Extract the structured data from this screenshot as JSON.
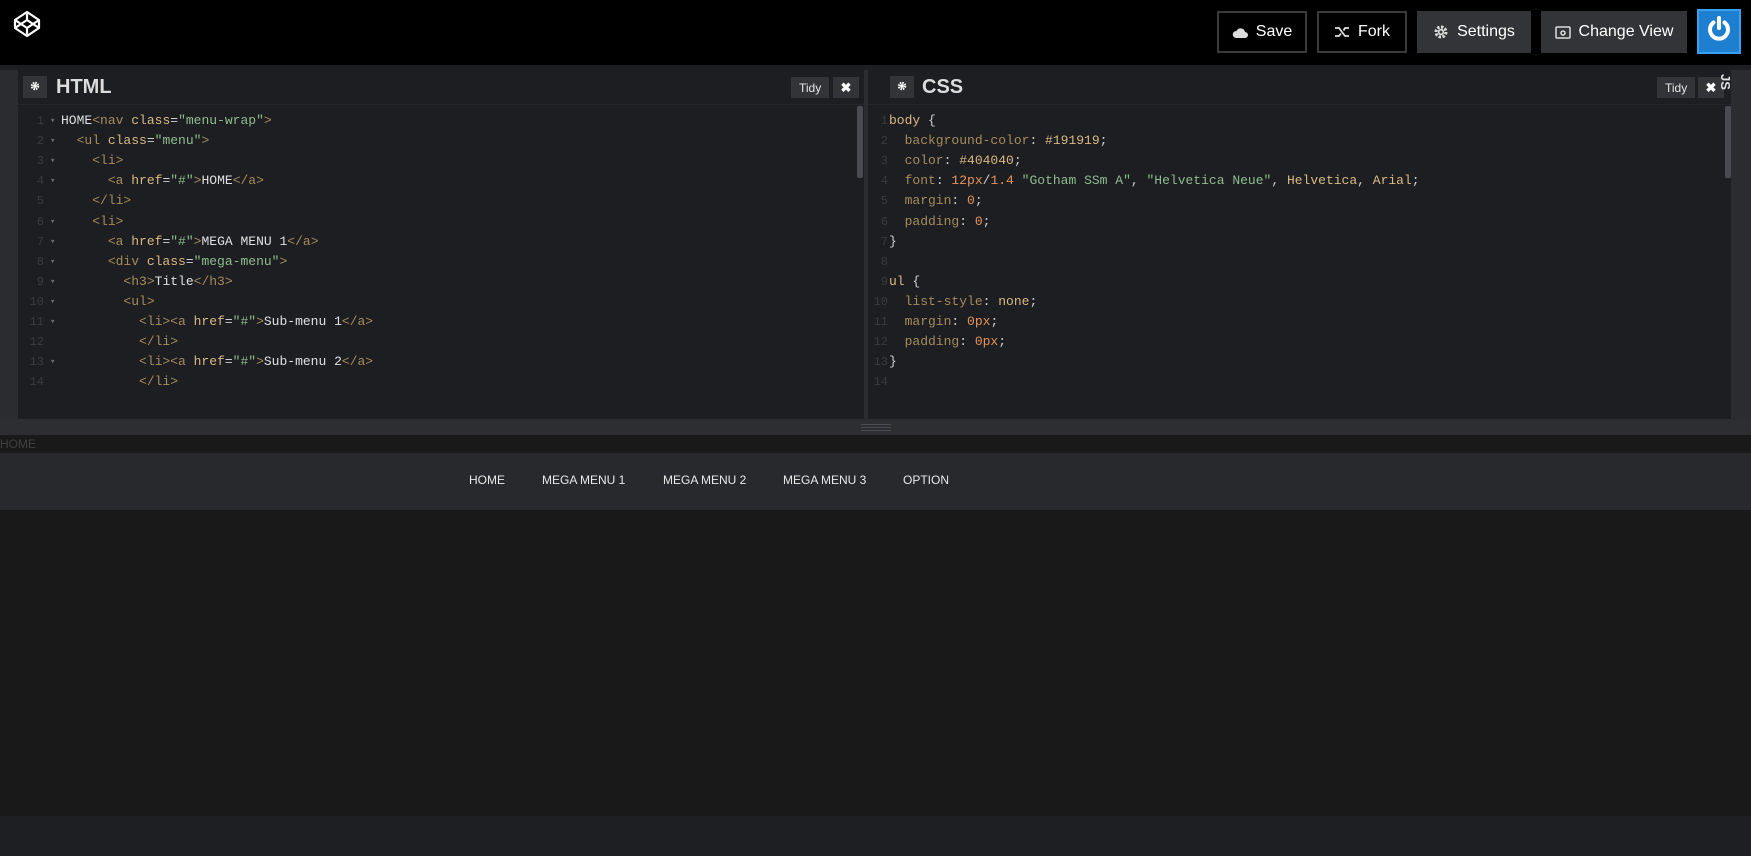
{
  "header": {
    "logo_icon": "codepen-cube-icon",
    "save_label": "Save",
    "fork_label": "Fork",
    "settings_label": "Settings",
    "change_view_label": "Change View",
    "account_icon": "power-icon",
    "accent_color": "#1e7fd0"
  },
  "html_pane": {
    "title": "HTML",
    "tidy_label": "Tidy",
    "close_label": "✖",
    "lines": [
      {
        "n": "1",
        "fold": "▾",
        "code": [
          [
            "tx",
            "HOME"
          ],
          [
            "tg",
            "<nav "
          ],
          [
            "at",
            "class"
          ],
          [
            "pu",
            "="
          ],
          [
            "st",
            "\"menu-wrap\""
          ],
          [
            "tg",
            ">"
          ]
        ]
      },
      {
        "n": "2",
        "fold": "▾",
        "code": [
          [
            "tx",
            "  "
          ],
          [
            "tg",
            "<ul "
          ],
          [
            "at",
            "class"
          ],
          [
            "pu",
            "="
          ],
          [
            "st",
            "\"menu\""
          ],
          [
            "tg",
            ">"
          ]
        ]
      },
      {
        "n": "3",
        "fold": "▾",
        "code": [
          [
            "tx",
            "    "
          ],
          [
            "tg",
            "<li>"
          ]
        ]
      },
      {
        "n": "4",
        "fold": "▾",
        "code": [
          [
            "tx",
            "      "
          ],
          [
            "tg",
            "<a "
          ],
          [
            "at",
            "href"
          ],
          [
            "pu",
            "="
          ],
          [
            "st",
            "\"#\""
          ],
          [
            "tg",
            ">"
          ],
          [
            "tx",
            "HOME"
          ],
          [
            "tg",
            "</a>"
          ]
        ]
      },
      {
        "n": "5",
        "fold": "",
        "code": [
          [
            "tx",
            "    "
          ],
          [
            "tg",
            "</li>"
          ]
        ]
      },
      {
        "n": "6",
        "fold": "▾",
        "code": [
          [
            "tx",
            "    "
          ],
          [
            "tg",
            "<li>"
          ]
        ]
      },
      {
        "n": "7",
        "fold": "▾",
        "code": [
          [
            "tx",
            "      "
          ],
          [
            "tg",
            "<a "
          ],
          [
            "at",
            "href"
          ],
          [
            "pu",
            "="
          ],
          [
            "st",
            "\"#\""
          ],
          [
            "tg",
            ">"
          ],
          [
            "tx",
            "MEGA MENU 1"
          ],
          [
            "tg",
            "</a>"
          ]
        ]
      },
      {
        "n": "8",
        "fold": "▾",
        "code": [
          [
            "tx",
            "      "
          ],
          [
            "tg",
            "<div "
          ],
          [
            "at",
            "class"
          ],
          [
            "pu",
            "="
          ],
          [
            "st",
            "\"mega-menu\""
          ],
          [
            "tg",
            ">"
          ]
        ]
      },
      {
        "n": "9",
        "fold": "▾",
        "code": [
          [
            "tx",
            "        "
          ],
          [
            "tg",
            "<h3>"
          ],
          [
            "tx",
            "Title"
          ],
          [
            "tg",
            "</h3>"
          ]
        ]
      },
      {
        "n": "10",
        "fold": "▾",
        "code": [
          [
            "tx",
            "        "
          ],
          [
            "tg",
            "<ul>"
          ]
        ]
      },
      {
        "n": "11",
        "fold": "▾",
        "code": [
          [
            "tx",
            "          "
          ],
          [
            "tg",
            "<li><a "
          ],
          [
            "at",
            "href"
          ],
          [
            "pu",
            "="
          ],
          [
            "st",
            "\"#\""
          ],
          [
            "tg",
            ">"
          ],
          [
            "tx",
            "Sub-menu 1"
          ],
          [
            "tg",
            "</a>"
          ]
        ]
      },
      {
        "n": "12",
        "fold": "",
        "code": [
          [
            "tx",
            "          "
          ],
          [
            "tg",
            "</li>"
          ]
        ]
      },
      {
        "n": "13",
        "fold": "▾",
        "code": [
          [
            "tx",
            "          "
          ],
          [
            "tg",
            "<li><a "
          ],
          [
            "at",
            "href"
          ],
          [
            "pu",
            "="
          ],
          [
            "st",
            "\"#\""
          ],
          [
            "tg",
            ">"
          ],
          [
            "tx",
            "Sub-menu 2"
          ],
          [
            "tg",
            "</a>"
          ]
        ]
      },
      {
        "n": "14",
        "fold": "",
        "code": [
          [
            "tx",
            "          "
          ],
          [
            "tg",
            "</li>"
          ]
        ]
      }
    ]
  },
  "css_pane": {
    "title": "CSS",
    "tidy_label": "Tidy",
    "close_label": "✖",
    "lines": [
      {
        "n": "1",
        "code": [
          [
            "sel",
            "body"
          ],
          [
            "pu",
            " {"
          ]
        ]
      },
      {
        "n": "2",
        "code": [
          [
            "pr",
            "  background-color"
          ],
          [
            "pu",
            ": "
          ],
          [
            "hex",
            "#191919"
          ],
          [
            "pu",
            ";"
          ]
        ]
      },
      {
        "n": "3",
        "code": [
          [
            "pr",
            "  color"
          ],
          [
            "pu",
            ": "
          ],
          [
            "hex",
            "#404040"
          ],
          [
            "pu",
            ";"
          ]
        ]
      },
      {
        "n": "4",
        "code": [
          [
            "pr",
            "  font"
          ],
          [
            "pu",
            ": "
          ],
          [
            "num",
            "12px"
          ],
          [
            "pu",
            "/"
          ],
          [
            "num",
            "1.4"
          ],
          [
            "pu",
            " "
          ],
          [
            "st",
            "\"Gotham SSm A\""
          ],
          [
            "pu",
            ", "
          ],
          [
            "st",
            "\"Helvetica Neue\""
          ],
          [
            "pu",
            ", "
          ],
          [
            "hex",
            "Helvetica"
          ],
          [
            "pu",
            ", "
          ],
          [
            "hex",
            "Arial"
          ],
          [
            "pu",
            ";"
          ]
        ]
      },
      {
        "n": "5",
        "code": [
          [
            "pr",
            "  margin"
          ],
          [
            "pu",
            ": "
          ],
          [
            "num",
            "0"
          ],
          [
            "pu",
            ";"
          ]
        ]
      },
      {
        "n": "6",
        "code": [
          [
            "pr",
            "  padding"
          ],
          [
            "pu",
            ": "
          ],
          [
            "num",
            "0"
          ],
          [
            "pu",
            ";"
          ]
        ]
      },
      {
        "n": "7",
        "code": [
          [
            "pu",
            "}"
          ]
        ]
      },
      {
        "n": "8",
        "code": []
      },
      {
        "n": "9",
        "code": [
          [
            "sel",
            "ul"
          ],
          [
            "pu",
            " {"
          ]
        ]
      },
      {
        "n": "10",
        "code": [
          [
            "pr",
            "  list-style"
          ],
          [
            "pu",
            ": "
          ],
          [
            "hex",
            "none"
          ],
          [
            "pu",
            ";"
          ]
        ]
      },
      {
        "n": "11",
        "code": [
          [
            "pr",
            "  margin"
          ],
          [
            "pu",
            ": "
          ],
          [
            "num",
            "0px"
          ],
          [
            "pu",
            ";"
          ]
        ]
      },
      {
        "n": "12",
        "code": [
          [
            "pr",
            "  padding"
          ],
          [
            "pu",
            ": "
          ],
          [
            "num",
            "0px"
          ],
          [
            "pu",
            ";"
          ]
        ]
      },
      {
        "n": "13",
        "code": [
          [
            "pu",
            "}"
          ]
        ]
      },
      {
        "n": "14",
        "code": []
      }
    ]
  },
  "js_tab": {
    "label": "JS"
  },
  "preview": {
    "home_text": "HOME",
    "menu": [
      "HOME",
      "MEGA MENU 1",
      "MEGA MENU 2",
      "MEGA MENU 3",
      "OPTION"
    ]
  }
}
